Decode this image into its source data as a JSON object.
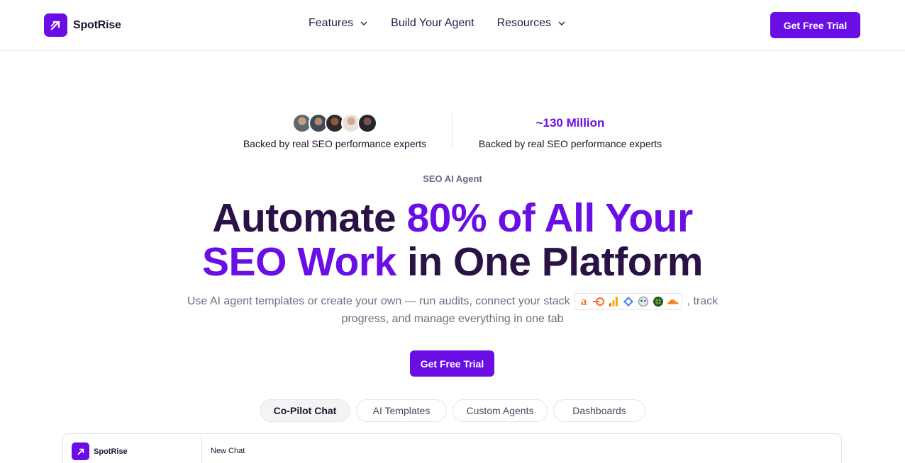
{
  "brand": {
    "name": "SpotRise",
    "accent": "#6a0ee6"
  },
  "nav": {
    "items": [
      {
        "label": "Features",
        "has_dropdown": true
      },
      {
        "label": "Build Your Agent",
        "has_dropdown": false
      },
      {
        "label": "Resources",
        "has_dropdown": true
      }
    ],
    "cta_label": "Get Free Trial"
  },
  "stats": {
    "left": {
      "caption": "Backed by real SEO performance experts",
      "avatar_count": 5
    },
    "right": {
      "value": "~130 Million",
      "caption": "Backed by real SEO performance experts"
    }
  },
  "hero": {
    "eyebrow": "SEO AI Agent",
    "headline": {
      "part1": "Automate ",
      "part2": "80% of All Your",
      "part3": "SEO Work",
      "part4": " in One Platform"
    },
    "subline_before": "Use AI agent templates or create your own — run audits, connect your stack ",
    "subline_after": " , track progress, and manage everything in one tab",
    "tool_icons": [
      "ahrefs-icon",
      "semrush-icon",
      "google-analytics-icon",
      "search-console-icon",
      "screaming-frog-icon",
      "majestic-icon",
      "cloudflare-icon"
    ],
    "cta_label": "Get Free Trial"
  },
  "tabs": [
    {
      "label": "Co-Pilot Chat",
      "active": true
    },
    {
      "label": "AI Templates",
      "active": false
    },
    {
      "label": "Custom Agents",
      "active": false
    },
    {
      "label": "Dashboards",
      "active": false
    }
  ],
  "preview": {
    "brand": "SpotRise",
    "chat_title": "New Chat"
  }
}
